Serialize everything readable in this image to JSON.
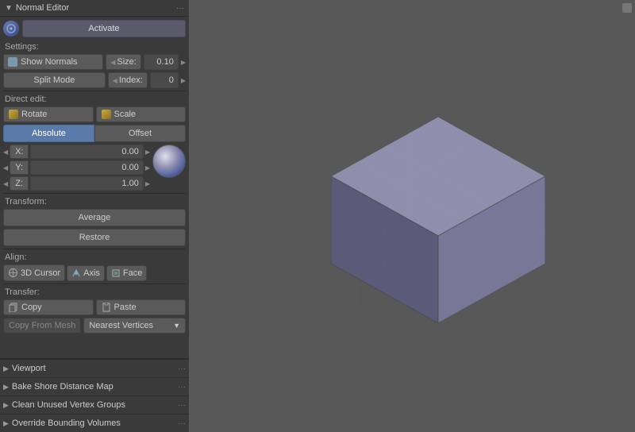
{
  "panel": {
    "title": "Normal Editor",
    "dots": "···",
    "activate_label": "Activate",
    "settings_label": "Settings:",
    "show_normals_label": "Show Normals",
    "size_label": "Size:",
    "size_value": "0.10",
    "split_mode_label": "Split Mode",
    "index_label": "Index:",
    "index_value": "0",
    "direct_edit_label": "Direct edit:",
    "rotate_label": "Rotate",
    "scale_label": "Scale",
    "tab_absolute": "Absolute",
    "tab_offset": "Offset",
    "x_label": "X:",
    "x_value": "0.00",
    "y_label": "Y:",
    "y_value": "0.00",
    "z_label": "Z:",
    "z_value": "1.00",
    "transform_label": "Transform:",
    "average_label": "Average",
    "restore_label": "Restore",
    "align_label": "Align:",
    "cursor_label": "3D Cursor",
    "axis_label": "Axis",
    "face_label": "Face",
    "transfer_label": "Transfer:",
    "copy_label": "Copy",
    "paste_label": "Paste",
    "copy_from_mesh_label": "Copy From Mesh",
    "nearest_vertices_label": "Nearest Vertices",
    "viewport_section": "Viewport",
    "bake_shore_label": "Bake Shore Distance Map",
    "clean_unused_label": "Clean Unused Vertex Groups",
    "override_bounding_label": "Override Bounding Volumes"
  }
}
